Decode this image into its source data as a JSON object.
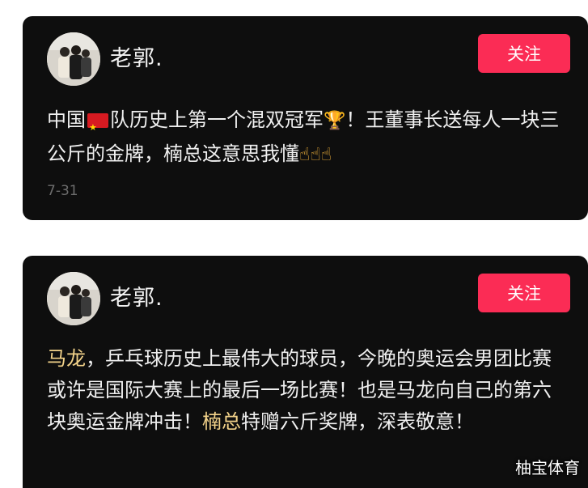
{
  "posts": [
    {
      "username": "老郭.",
      "follow_label": "关注",
      "text_parts": [
        {
          "text": "中国",
          "highlight": false
        },
        {
          "text": "队历史上第一个混双冠军",
          "highlight": false
        },
        {
          "text": "！王董事长送每人一块三公斤的金牌，楠总这意思我懂",
          "highlight": false
        }
      ],
      "trophy_emoji": "🏆",
      "hand_emojis": "☝☝☝",
      "date": "7-31"
    },
    {
      "username": "老郭.",
      "follow_label": "关注",
      "text_parts": [
        {
          "text": "马龙",
          "highlight": true
        },
        {
          "text": "，乒乓球历史上最伟大的球员，今晚的奥运会男团比赛或许是国际大赛上的最后一场比赛！也是马龙向自己的第六块奥运金牌冲击！",
          "highlight": false
        },
        {
          "text": "楠总",
          "highlight": true
        },
        {
          "text": "特赠六斤奖牌，深表敬意！",
          "highlight": false
        }
      ]
    }
  ],
  "watermark": "柚宝体育",
  "colors": {
    "card_bg": "#0e0e0e",
    "follow_button": "#fb2c55",
    "highlight": "#f3d38a",
    "date": "#6d6d6d"
  },
  "icons": [
    "avatar-photo",
    "china-flag-icon",
    "trophy-icon",
    "pointing-up-hand-icon"
  ]
}
